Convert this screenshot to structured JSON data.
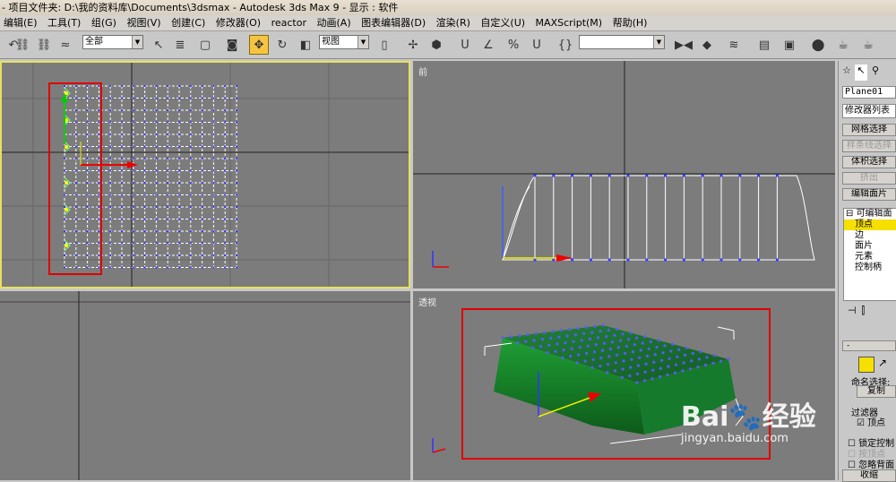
{
  "title_bar": {
    "text": "- 项目文件夹: D:\\我的资料库\\Documents\\3dsmax    - Autodesk 3ds Max 9    - 显示 : 软件"
  },
  "menu": [
    "编辑(E)",
    "工具(T)",
    "组(G)",
    "视图(V)",
    "创建(C)",
    "修改器(O)",
    "reactor",
    "动画(A)",
    "图表编辑器(D)",
    "渲染(R)",
    "自定义(U)",
    "MAXScript(M)",
    "帮助(H)"
  ],
  "toolbar": {
    "selection_filter": "全部",
    "reference_coord": "视图",
    "named_selection": ""
  },
  "viewports": {
    "top_label": "",
    "front_label": "前",
    "left_label": "",
    "persp_label": "透视"
  },
  "panel": {
    "object_name": "Plane01",
    "modifier_list": "修改器列表",
    "buttons": [
      "网格选择",
      "样条线选择",
      "体积选择",
      "挤出",
      "编辑面片"
    ],
    "stack": [
      "可编辑面",
      "顶点",
      "边",
      "面片",
      "元素",
      "控制柄"
    ],
    "named_selection_label": "命名选择:",
    "copy_button": "复制",
    "filter_label": "过滤器",
    "vertex_checkbox": "顶点",
    "lock_label": "锁定控制",
    "handle_label": "按顶点",
    "ignore_label": "忽略背面",
    "shrink_button": "收缩"
  },
  "watermark": {
    "brand": "Bai",
    "brand2": "经验",
    "url": "jingyan.baidu.com"
  },
  "colors": {
    "viewport_bg": "#7c7c7c",
    "active_border": "#e8e060",
    "highlight_red": "#e00000",
    "mesh_green": "#1f8f2f"
  }
}
